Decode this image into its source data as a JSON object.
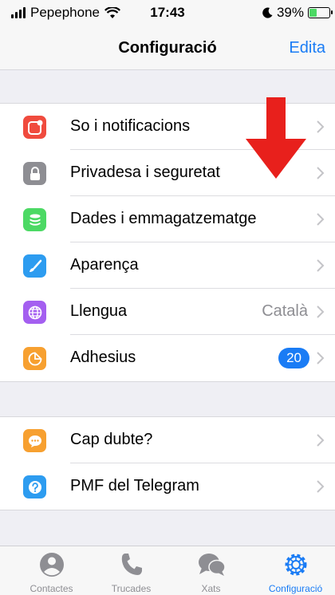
{
  "status_bar": {
    "carrier": "Pepephone",
    "time": "17:43",
    "battery": "39%",
    "battery_level": 0.39
  },
  "nav": {
    "title": "Configuració",
    "edit_label": "Edita"
  },
  "groups": [
    {
      "items": [
        {
          "label": "So i notificacions",
          "icon": "bell-icon",
          "color": "#f04b3e"
        },
        {
          "label": "Privadesa i seguretat",
          "icon": "lock-icon",
          "color": "#8e8e93"
        },
        {
          "label": "Dades i emmagatzematge",
          "icon": "database-icon",
          "color": "#4cd964"
        },
        {
          "label": "Aparença",
          "icon": "brush-icon",
          "color": "#2d9cf0"
        },
        {
          "label": "Llengua",
          "icon": "globe-icon",
          "color": "#a45ff0",
          "value": "Català"
        },
        {
          "label": "Adhesius",
          "icon": "sticker-icon",
          "color": "#f7a030",
          "badge": "20"
        }
      ]
    },
    {
      "items": [
        {
          "label": "Cap dubte?",
          "icon": "chat-bubble-icon",
          "color": "#f7a030"
        },
        {
          "label": "PMF del Telegram",
          "icon": "question-icon",
          "color": "#2d9cf0"
        }
      ]
    }
  ],
  "tabs": [
    {
      "label": "Contactes",
      "icon": "person-icon",
      "active": false
    },
    {
      "label": "Trucades",
      "icon": "phone-icon",
      "active": false
    },
    {
      "label": "Xats",
      "icon": "chats-icon",
      "active": false
    },
    {
      "label": "Configuració",
      "icon": "gear-icon",
      "active": true
    }
  ],
  "colors": {
    "accent": "#1a7cf5",
    "annotation_arrow": "#e8201c"
  }
}
